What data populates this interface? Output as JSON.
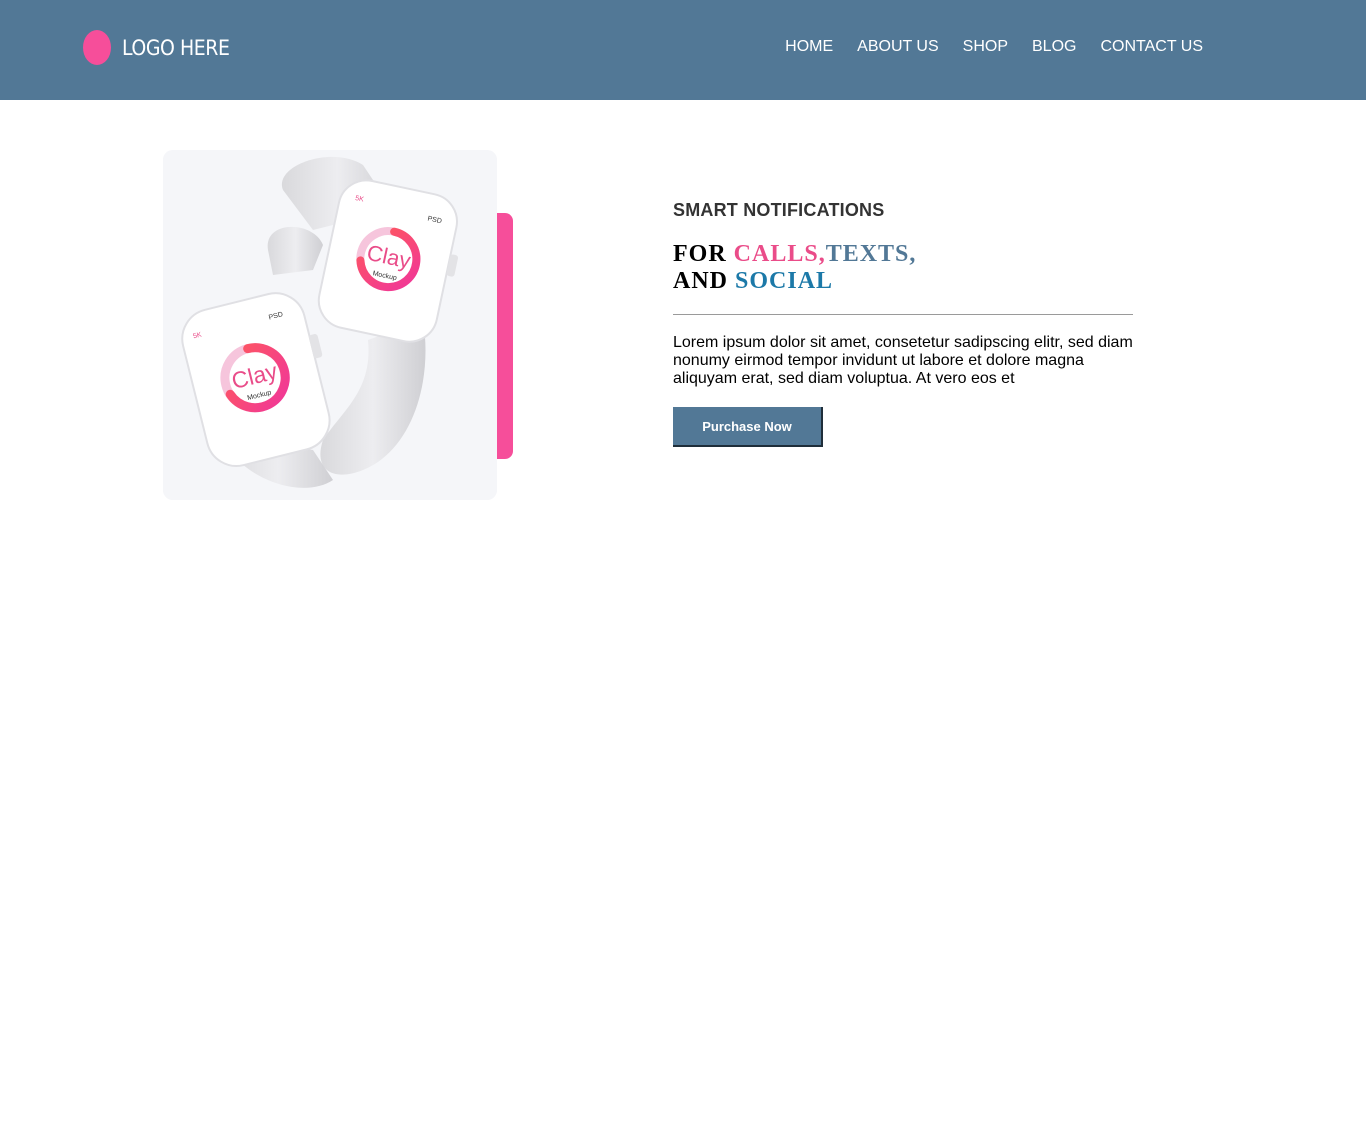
{
  "header": {
    "logo_text": "LOGO HERE",
    "nav": [
      "HOME",
      "ABOUT US",
      "SHOP",
      "BLOG",
      "CONTACT US"
    ]
  },
  "hero": {
    "image_text": {
      "watch_brand": "Clay",
      "watch_subtitle": "Mockup",
      "badge_5k": "5K",
      "badge_psd": "PSD"
    }
  },
  "content": {
    "eyebrow": "SMART NOTIFICATIONS",
    "headline_for": "FOR",
    "headline_calls": "CALLS,",
    "headline_texts": "TEXTS,",
    "headline_and": "AND",
    "headline_social": "SOCIAL",
    "body": "Lorem ipsum dolor sit amet, consetetur sadipscing elitr, sed diam nonumy eirmod tempor invidunt ut labore et dolore magna aliquyam erat, sed diam voluptua. At vero eos et",
    "cta_label": "Purchase Now"
  },
  "colors": {
    "header_bg": "#527896",
    "accent_pink": "#f64e9a",
    "accent_blue": "#1c79a8"
  }
}
